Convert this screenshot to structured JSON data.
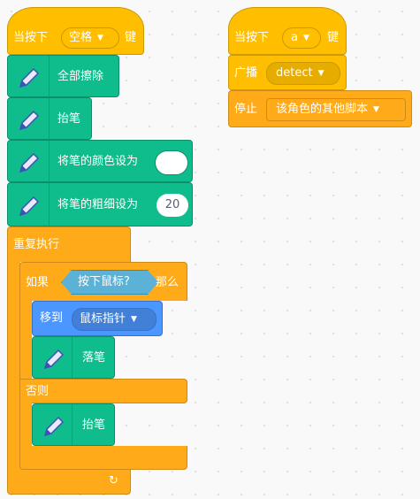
{
  "script1": {
    "when_key_pressed": {
      "prefix": "当按下",
      "key": "空格",
      "suffix": "键"
    },
    "erase_all": {
      "label": "全部擦除"
    },
    "pen_up_1": {
      "label": "抬笔"
    },
    "set_color": {
      "label": "将笔的颜色设为"
    },
    "set_size": {
      "label": "将笔的粗细设为",
      "value": "20"
    },
    "forever": {
      "label": "重复执行"
    },
    "if_else": {
      "if_label": "如果",
      "condition": "按下鼠标?",
      "then_label": "那么",
      "goto": {
        "label": "移到",
        "target": "鼠标指针"
      },
      "pen_down": {
        "label": "落笔"
      },
      "else_label": "否则",
      "pen_up_2": {
        "label": "抬笔"
      }
    },
    "loop_arrow": "↻"
  },
  "script2": {
    "when_key_pressed": {
      "prefix": "当按下",
      "key": "a",
      "suffix": "键"
    },
    "broadcast": {
      "label": "广播",
      "message": "detect"
    },
    "stop": {
      "label": "停止",
      "option": "该角色的其他脚本"
    }
  },
  "colors": {
    "events": "#ffbf00",
    "control": "#ffab19",
    "pen": "#0fbd8c",
    "motion": "#4c97ff",
    "sensing": "#5cb1d6",
    "pen_color_value": "#ffffff"
  }
}
